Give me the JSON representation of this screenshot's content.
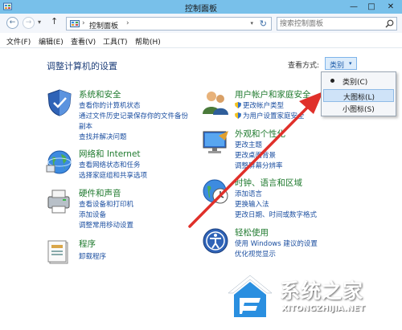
{
  "window": {
    "title": "控制面板",
    "minimize": "—",
    "maximize": "□",
    "close": "✕"
  },
  "nav": {
    "back": "←",
    "forward": "→",
    "dropdown": "▾",
    "up": "↑",
    "breadcrumb": "控制面板",
    "sep1": "›",
    "sep2": "›",
    "address_dropdown": "▾",
    "refresh": "↻",
    "search_placeholder": "搜索控制面板"
  },
  "menu": [
    "文件(F)",
    "编辑(E)",
    "查看(V)",
    "工具(T)",
    "帮助(H)"
  ],
  "main": {
    "title": "调整计算机的设置",
    "viewby_label": "查看方式:",
    "viewby_value": "类别",
    "viewby_arrow": "▾"
  },
  "categories_left": [
    {
      "title": "系统和安全",
      "links": [
        "查看你的计算机状态",
        "通过文件历史记录保存你的文件备份",
        "副本",
        "查找并解决问题"
      ]
    },
    {
      "title": "网络和 Internet",
      "links": [
        "查看网络状态和任务",
        "选择家庭组和共享选项"
      ]
    },
    {
      "title": "硬件和声音",
      "links": [
        "查看设备和打印机",
        "添加设备",
        "调整常用移动设置"
      ]
    },
    {
      "title": "程序",
      "links": [
        "卸载程序"
      ]
    }
  ],
  "categories_right": [
    {
      "title": "用户帐户和家庭安全",
      "links": [
        "更改帐户类型",
        "为用户设置家庭安全"
      ]
    },
    {
      "title": "外观和个性化",
      "links": [
        "更改主题",
        "更改桌面背景",
        "调整屏幕分辨率"
      ]
    },
    {
      "title": "时钟、语言和区域",
      "links": [
        "添加语言",
        "更换输入法",
        "更改日期、时间或数字格式"
      ]
    },
    {
      "title": "轻松使用",
      "links": [
        "使用 Windows 建议的设置",
        "优化视觉显示"
      ]
    }
  ],
  "popup": {
    "items": [
      {
        "label": "类别(C)",
        "selected": true
      },
      {
        "label": "大图标(L)",
        "selected": false
      },
      {
        "label": "小图标(S)",
        "selected": false
      }
    ]
  },
  "watermark": {
    "brand": "系统之家",
    "domain": "XITONGZHIJIA.NET"
  },
  "colors": {
    "titlebar": "#78c0ea",
    "link": "#1c4fa0",
    "category": "#1f7a2e",
    "arrow": "#e0302a",
    "heading": "#1e3f7a"
  },
  "icons": [
    "window-icon",
    "back-icon",
    "forward-icon",
    "up-icon",
    "control-panel-icon",
    "refresh-icon",
    "search-icon",
    "shield-icon",
    "network-icon",
    "hardware-icon",
    "programs-icon",
    "users-icon",
    "appearance-icon",
    "clock-icon",
    "ease-of-access-icon",
    "arrow-annotation-icon",
    "logo-icon"
  ]
}
